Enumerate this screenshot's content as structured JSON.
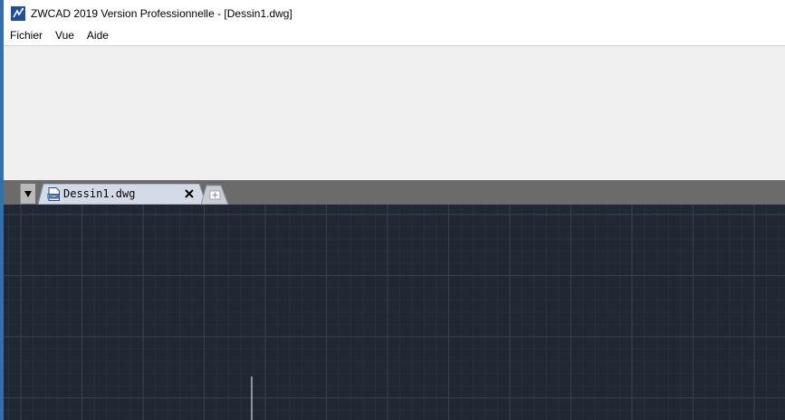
{
  "window": {
    "title": "ZWCAD 2019 Version Professionnelle - [Dessin1.dwg]",
    "app_icon": "zwcad-logo-icon"
  },
  "menubar": {
    "items": [
      {
        "label": "Fichier"
      },
      {
        "label": "Vue"
      },
      {
        "label": "Aide"
      }
    ]
  },
  "tabs": {
    "dropdown_icon": "triangle-down-icon",
    "documents": [
      {
        "label": "Dessin1.dwg",
        "icon": "dwg-file-icon",
        "close_icon": "close-icon"
      }
    ],
    "new_tab_icon": "new-tab-plus-icon"
  },
  "canvas": {
    "background": "#222833",
    "grid_color": "#3a414d",
    "cursor_color": "#ffffff"
  }
}
